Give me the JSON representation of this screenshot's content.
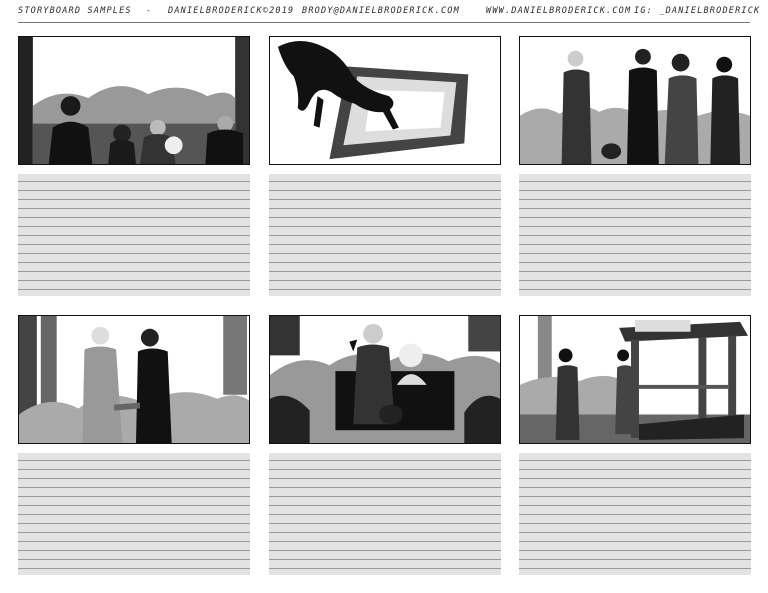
{
  "header": {
    "title": "STORYBOARD SAMPLES",
    "dash": "-",
    "copyright": "DANIELBRODERICK©2019",
    "email": "BRODY@DANIELBRODERICK.COM",
    "website": "WWW.DANIELBRODERICK.COM",
    "social": "IG: _DANIELBRODERICK"
  },
  "panels": [
    {
      "scene": "group-portrait-with-dogs"
    },
    {
      "scene": "dog-on-cushion"
    },
    {
      "scene": "people-walking-outdoors"
    },
    {
      "scene": "handshake"
    },
    {
      "scene": "man-with-pomeranian-peace-sign"
    },
    {
      "scene": "women-approaching-doghouse"
    }
  ]
}
